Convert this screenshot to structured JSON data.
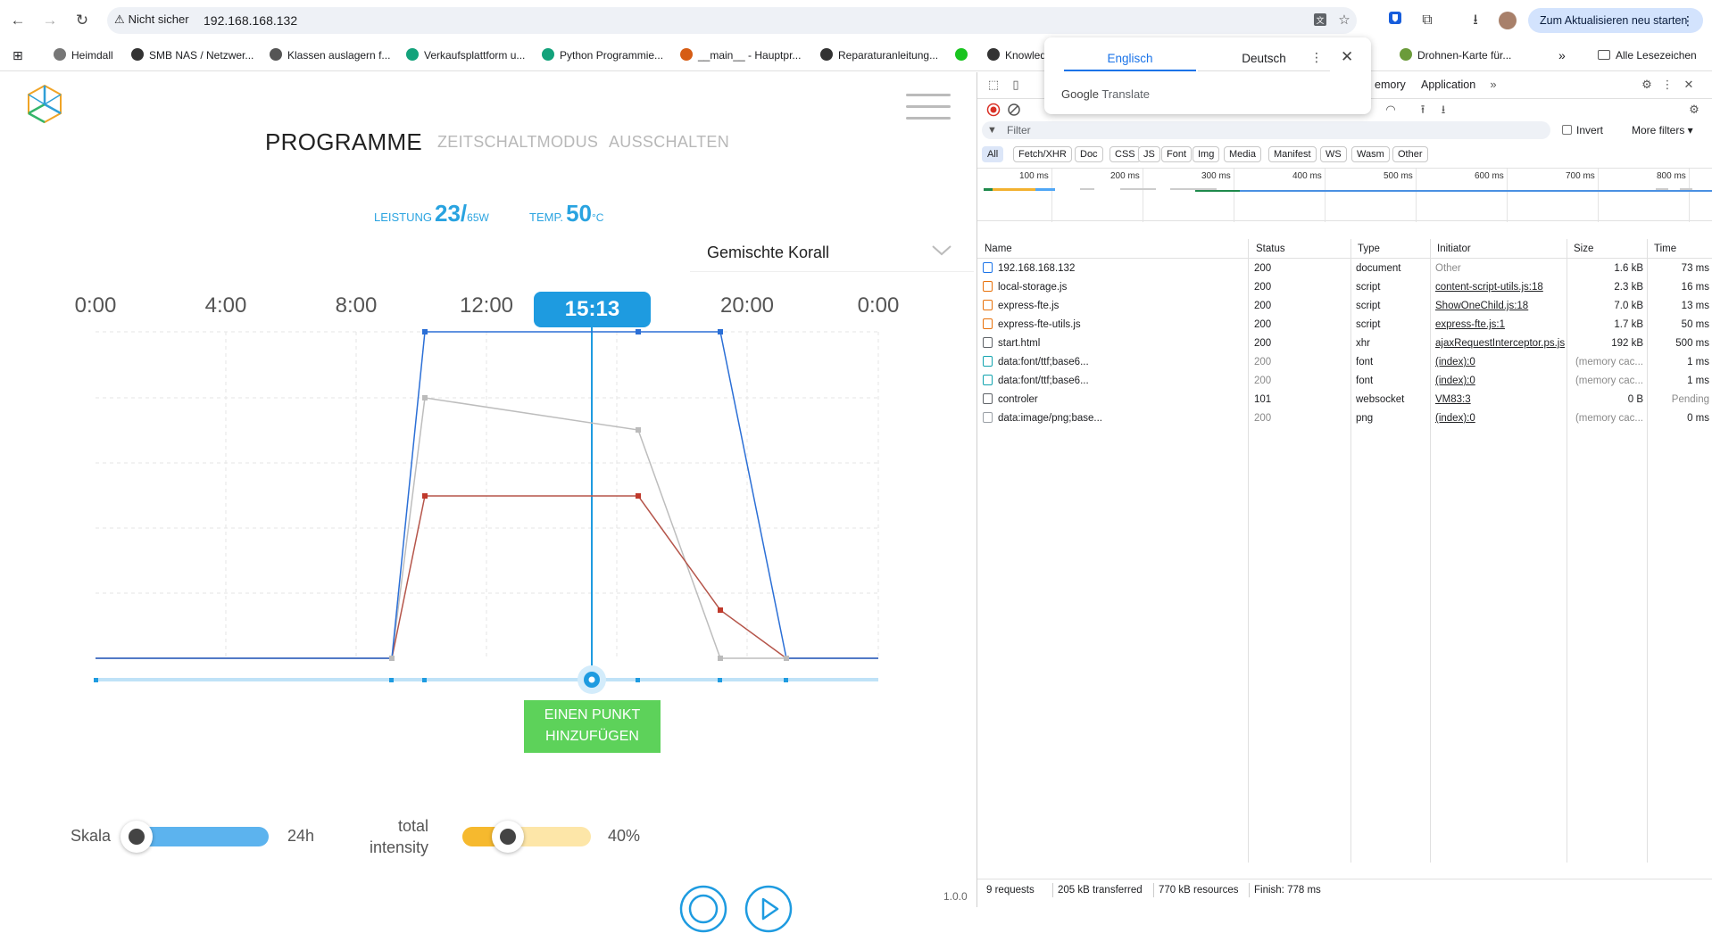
{
  "browser": {
    "security_label": "Nicht sicher",
    "url": "192.168.168.132",
    "update_button": "Zum Aktualisieren neu starten",
    "bookmarks": [
      {
        "label": "Heimdall",
        "color": "#777777"
      },
      {
        "label": "SMB NAS / Netzwer...",
        "color": "#333333"
      },
      {
        "label": "Klassen auslagern f...",
        "color": "#555555"
      },
      {
        "label": "Verkaufsplattform u...",
        "color": "#13a27b"
      },
      {
        "label": "Python Programmie...",
        "color": "#13a27b"
      },
      {
        "label": "__main__ - Hauptpr...",
        "color": "#d65c14"
      },
      {
        "label": "Reparaturanleitung...",
        "color": "#333333"
      },
      {
        "label": "",
        "color": "#19c41f"
      },
      {
        "label": "Knowled",
        "color": "#333333"
      },
      {
        "label": "Drohnen-Karte für...",
        "color": "#6b9b3a"
      }
    ],
    "all_bookmarks": "Alle Lesezeichen"
  },
  "translate_popup": {
    "lang_from": "Englisch",
    "lang_to": "Deutsch",
    "brand_google": "Google",
    "brand_translate": "Translate"
  },
  "app": {
    "tabs": {
      "programme": "PROGRAMME",
      "zeitschalt": "ZEITSCHALTMODUS",
      "ausschalten": "AUSSCHALTEN"
    },
    "power": {
      "label": "LEISTUNG",
      "value": "23/",
      "unit": "65W"
    },
    "temp": {
      "label": "TEMP.",
      "value": "50",
      "unit": "°C"
    },
    "program_select": "Gemischte Korall",
    "hour_labels": [
      "0:00",
      "4:00",
      "8:00",
      "12:00",
      "20:00",
      "0:00"
    ],
    "current_time": "15:13",
    "add_point_line1": "EINEN PUNKT",
    "add_point_line2": "HINZUFÜGEN",
    "scale_label": "Skala",
    "scale_value": "24h",
    "intensity_label_1": "total",
    "intensity_label_2": "intensity",
    "intensity_value": "40%",
    "intensity_fraction": 0.4,
    "version": "1.0.0",
    "colors": {
      "blue": "#2b6fd6",
      "red": "#b5554a",
      "gray": "#b9b9b9",
      "accent": "#1e9be0",
      "green": "#5dd25a"
    }
  },
  "devtools": {
    "tabs": [
      "emory",
      "Application"
    ],
    "filter_placeholder": "Filter",
    "invert_label": "Invert",
    "more_filters": "More filters",
    "type_filters": [
      "All",
      "Fetch/XHR",
      "Doc",
      "CSS",
      "JS",
      "Font",
      "Img",
      "Media",
      "Manifest",
      "WS",
      "Wasm",
      "Other"
    ],
    "timeline_labels": [
      "100 ms",
      "200 ms",
      "300 ms",
      "400 ms",
      "500 ms",
      "600 ms",
      "700 ms",
      "800 ms"
    ],
    "columns": [
      "Name",
      "Status",
      "Type",
      "Initiator",
      "Size",
      "Time"
    ],
    "requests": [
      {
        "name": "192.168.168.132",
        "status": "200",
        "type": "document",
        "initiator": "Other",
        "size": "1.6 kB",
        "time": "73 ms",
        "icon": "doc"
      },
      {
        "name": "local-storage.js",
        "status": "200",
        "type": "script",
        "initiator": "content-script-utils.js:18",
        "size": "2.3 kB",
        "time": "16 ms",
        "icon": "script"
      },
      {
        "name": "express-fte.js",
        "status": "200",
        "type": "script",
        "initiator": "ShowOneChild.js:18",
        "size": "7.0 kB",
        "time": "13 ms",
        "icon": "script"
      },
      {
        "name": "express-fte-utils.js",
        "status": "200",
        "type": "script",
        "initiator": "express-fte.js:1",
        "size": "1.7 kB",
        "time": "50 ms",
        "icon": "script"
      },
      {
        "name": "start.html",
        "status": "200",
        "type": "xhr",
        "initiator": "ajaxRequestInterceptor.ps.js",
        "size": "192 kB",
        "time": "500 ms",
        "icon": "xhr"
      },
      {
        "name": "data:font/ttf;base6...",
        "status": "200",
        "type": "font",
        "initiator": "(index):0",
        "size": "(memory cac...",
        "time": "1 ms",
        "icon": "font"
      },
      {
        "name": "data:font/ttf;base6...",
        "status": "200",
        "type": "font",
        "initiator": "(index):0",
        "size": "(memory cac...",
        "time": "1 ms",
        "icon": "font"
      },
      {
        "name": "controler",
        "status": "101",
        "type": "websocket",
        "initiator": "VM83:3",
        "size": "0 B",
        "time": "Pending",
        "icon": "ws"
      },
      {
        "name": "data:image/png;base...",
        "status": "200",
        "type": "png",
        "initiator": "(index):0",
        "size": "(memory cac...",
        "time": "0 ms",
        "icon": "img"
      }
    ],
    "summary": {
      "requests": "9 requests",
      "transferred": "205 kB transferred",
      "resources": "770 kB resources",
      "finish": "Finish: 778 ms"
    }
  }
}
